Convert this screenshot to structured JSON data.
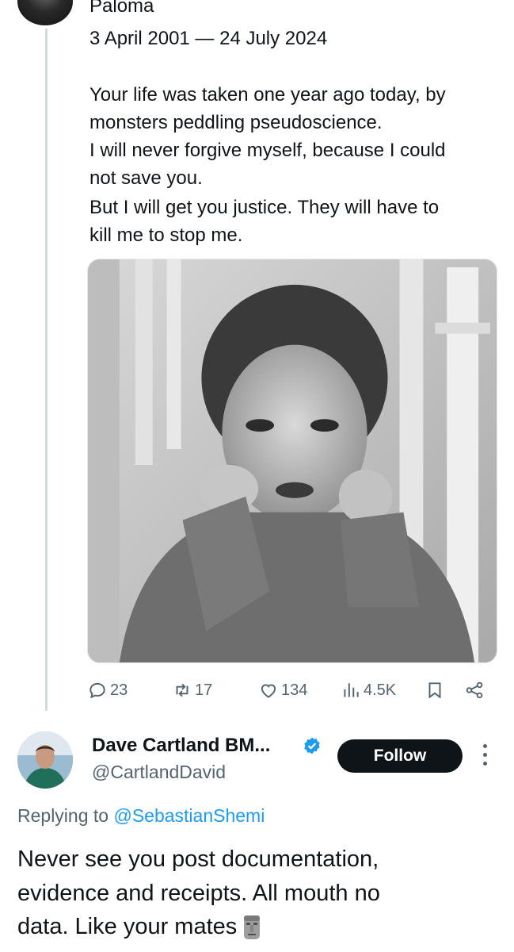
{
  "original_tweet": {
    "name_partial": "Paloma",
    "dates": "3 April 2001 — 24 July 2024",
    "lines": [
      "Your life was taken one year ago today, by",
      "monsters peddling pseudoscience.",
      "I will never forgive myself, because I could",
      "not save you.",
      "But I will get you justice. They will have to",
      "kill me to stop me."
    ],
    "stats": {
      "replies": "23",
      "reposts": "17",
      "likes": "134",
      "views": "4.5K"
    }
  },
  "reply": {
    "display_name": "Dave Cartland BM...",
    "handle": "@CartlandDavid",
    "follow_label": "Follow",
    "replying_prefix": "Replying to ",
    "replying_mention": "@SebastianShemi",
    "lines": [
      "Never see you post documentation,",
      "evidence and receipts. All mouth no",
      "data. Like your mates"
    ]
  },
  "colors": {
    "text": "#0f1419",
    "secondary": "#536471",
    "link": "#1d9bf0",
    "verified": "#1d9bf0",
    "follow_bg": "#0f1419"
  },
  "icons": [
    "reply-icon",
    "repost-icon",
    "like-icon",
    "views-icon",
    "bookmark-icon",
    "share-icon",
    "verified-badge-icon",
    "more-icon",
    "moai-emoji-icon"
  ]
}
